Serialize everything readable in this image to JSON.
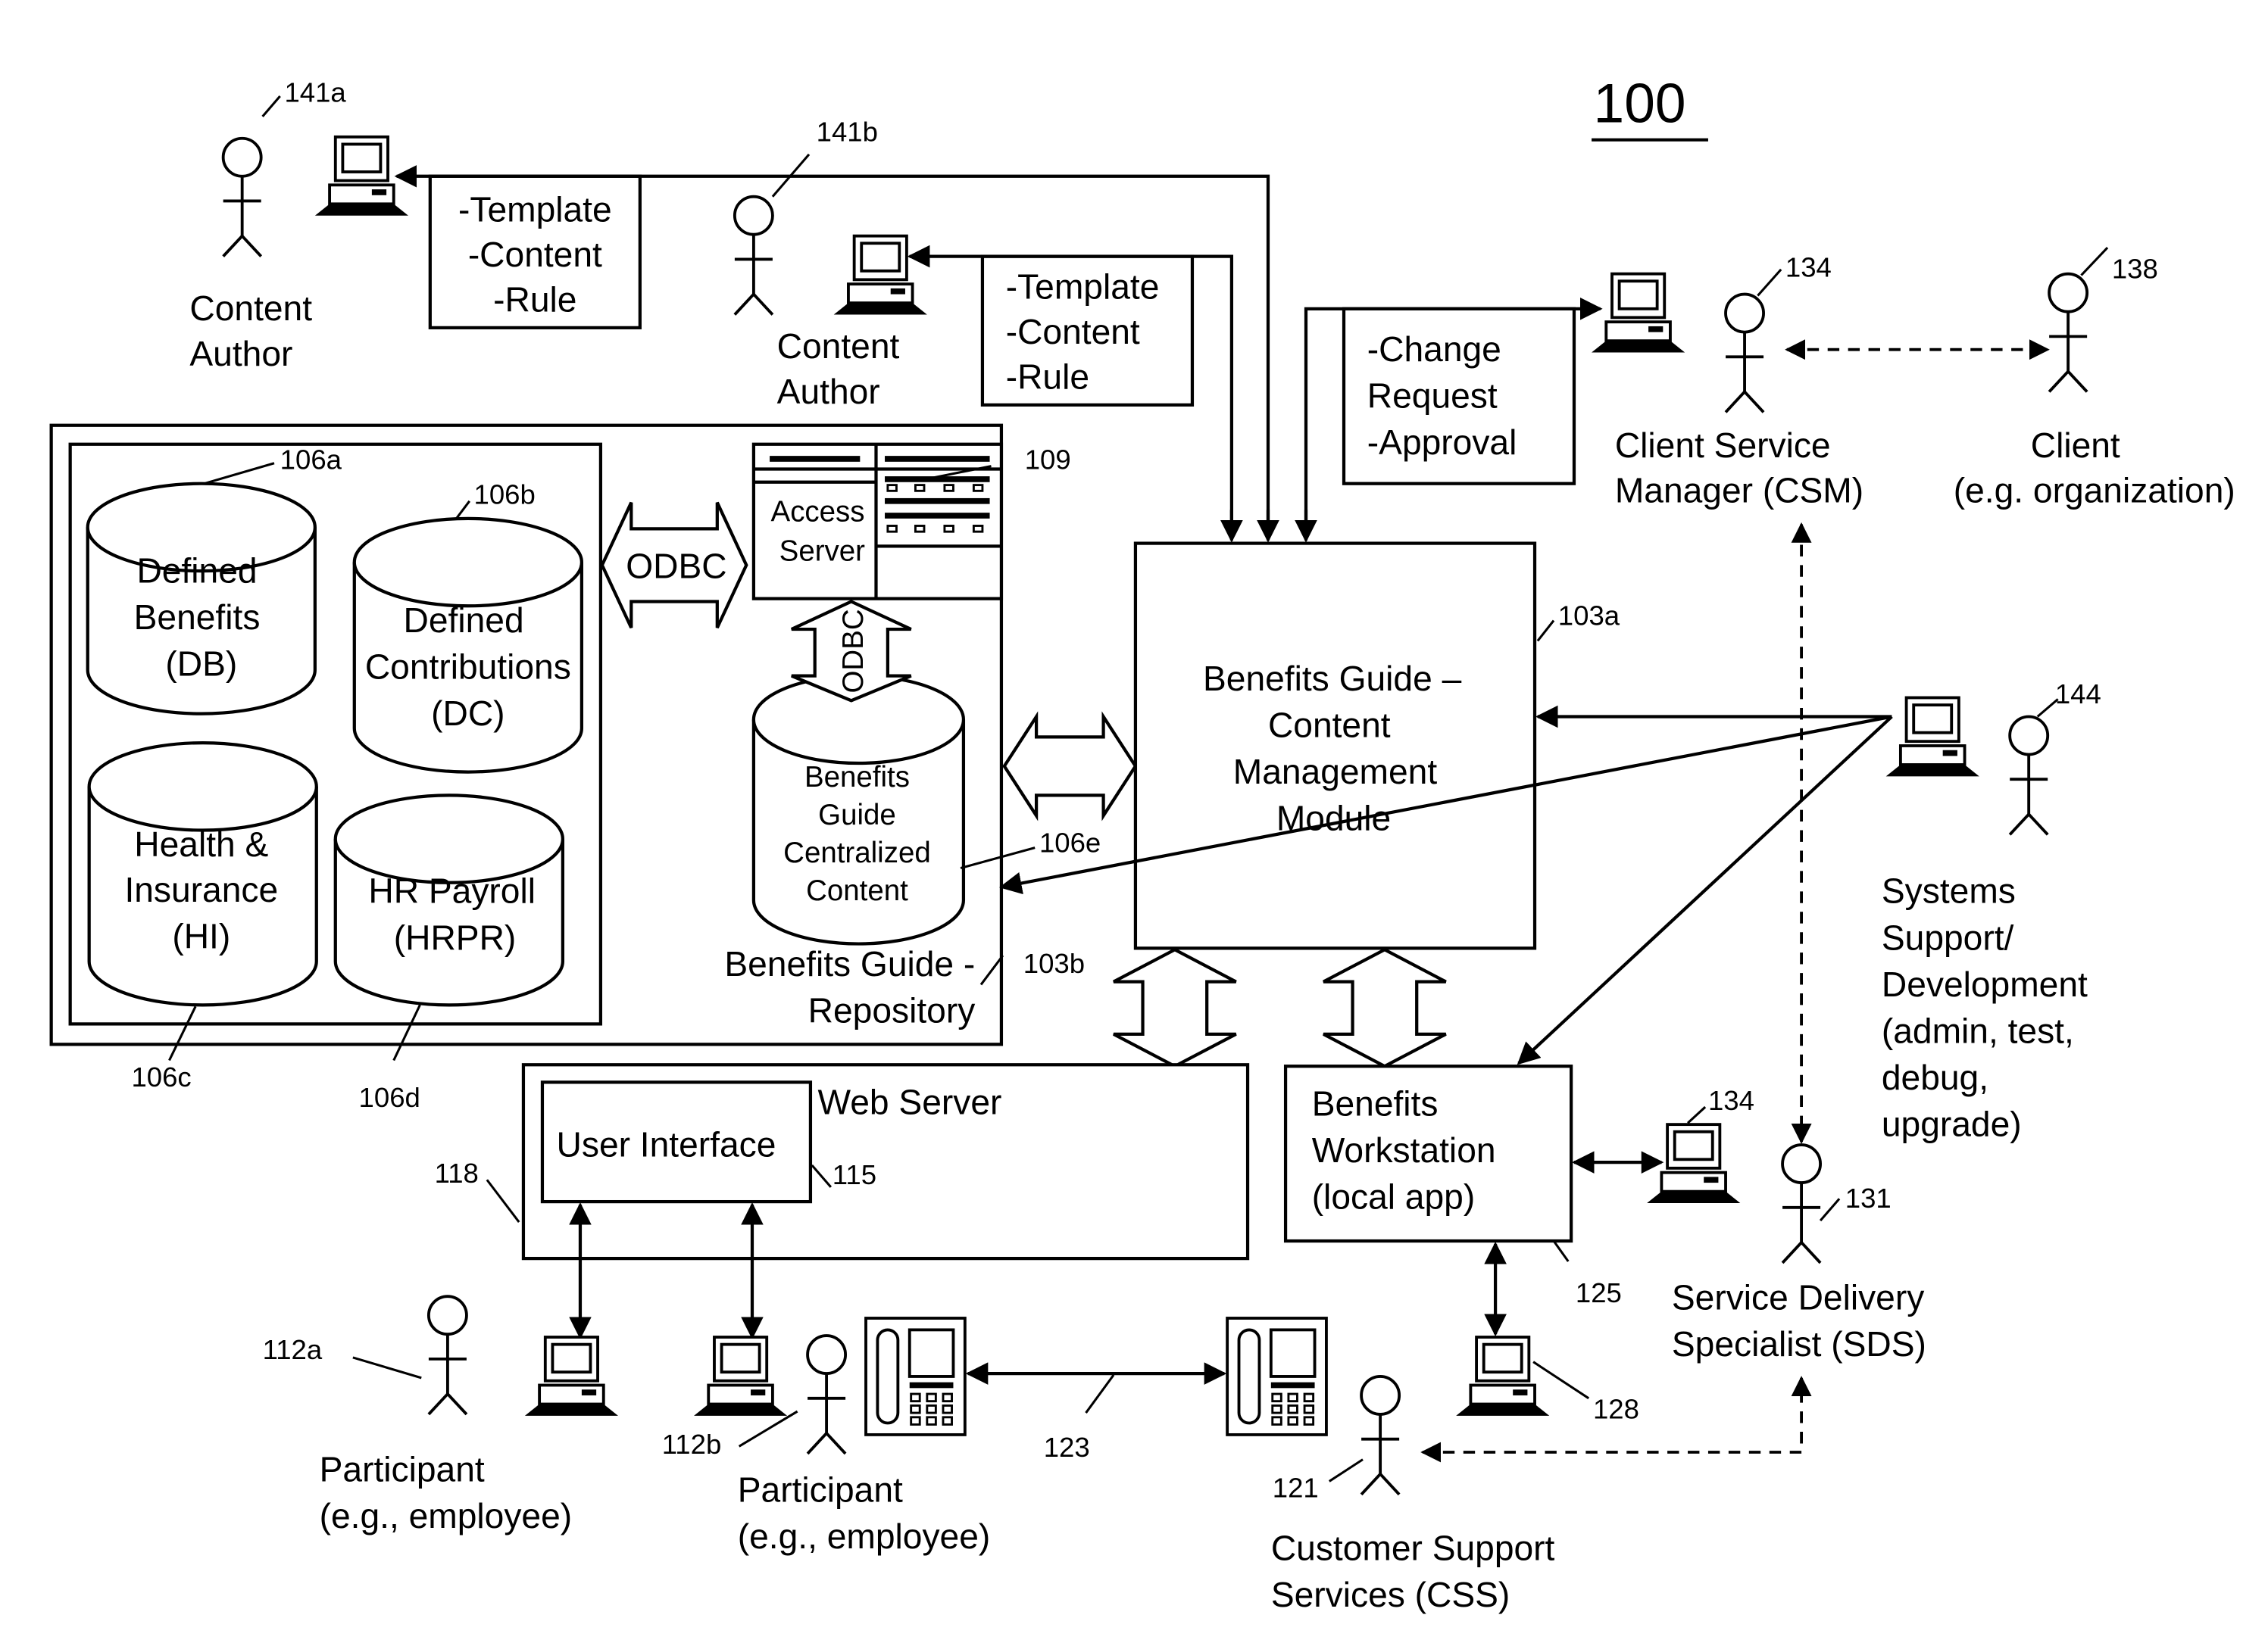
{
  "figure_number": "100",
  "actors": {
    "content_author_a": {
      "label": [
        "Content",
        "Author"
      ],
      "ref": "141a"
    },
    "content_author_b": {
      "label": [
        "Content",
        "Author"
      ],
      "ref": "141b"
    },
    "csm": {
      "label": [
        "Client Service",
        "Manager (CSM)"
      ],
      "ref": "134"
    },
    "client": {
      "label": [
        "Client",
        "(e.g. organization)"
      ],
      "ref": "138"
    },
    "systems_support": {
      "label": [
        "Systems",
        "Support/",
        "Development",
        "(admin, test,",
        "debug,",
        "upgrade)"
      ],
      "ref": "144"
    },
    "sds": {
      "label": [
        "Service Delivery",
        "Specialist (SDS)"
      ],
      "ref": "131"
    },
    "css": {
      "label": [
        "Customer Support",
        "Services (CSS)"
      ],
      "ref": "121"
    },
    "participant_a": {
      "label": [
        "Participant",
        "(e.g., employee)"
      ],
      "ref": "112a"
    },
    "participant_b": {
      "label": [
        "Participant",
        "(e.g., employee)"
      ],
      "ref": "112b"
    }
  },
  "notes": {
    "note_a": [
      "-Template",
      "-Content",
      "-Rule"
    ],
    "note_b": [
      "-Template",
      "-Content",
      "-Rule"
    ],
    "note_c": [
      "-Change",
      "Request",
      "-Approval"
    ]
  },
  "repository": {
    "label": [
      "Benefits Guide -",
      "Repository"
    ],
    "ref": "103b",
    "databases": [
      {
        "label": [
          "Defined",
          "Benefits",
          "(DB)"
        ],
        "ref": "106a"
      },
      {
        "label": [
          "Defined",
          "Contributions",
          "(DC)"
        ],
        "ref": "106b"
      },
      {
        "label": [
          "Health &",
          "Insurance",
          "(HI)"
        ],
        "ref": "106c"
      },
      {
        "label": [
          "HR Payroll",
          "(HRPR)"
        ],
        "ref": "106d"
      }
    ],
    "central_db": {
      "label": [
        "Benefits",
        "Guide",
        "Centralized",
        "Content"
      ],
      "ref": "106e"
    },
    "odbc_horizontal": "ODBC",
    "odbc_vertical": "ODBC",
    "access_server": {
      "label": [
        "Access",
        "Server"
      ],
      "ref": "109"
    }
  },
  "cms": {
    "label": [
      "Benefits Guide –",
      "Content",
      "Management",
      "Module"
    ],
    "ref": "103a"
  },
  "web_server": {
    "label": "Web Server",
    "ref": "118"
  },
  "user_interface": {
    "label": "User Interface",
    "ref": "115"
  },
  "workstation": {
    "label": [
      "Benefits",
      "Workstation",
      "(local app)"
    ],
    "ref": "125"
  },
  "computers": {
    "sds_pc_ref": "134",
    "css_pc_ref": "128"
  },
  "phone_link_ref": "123"
}
